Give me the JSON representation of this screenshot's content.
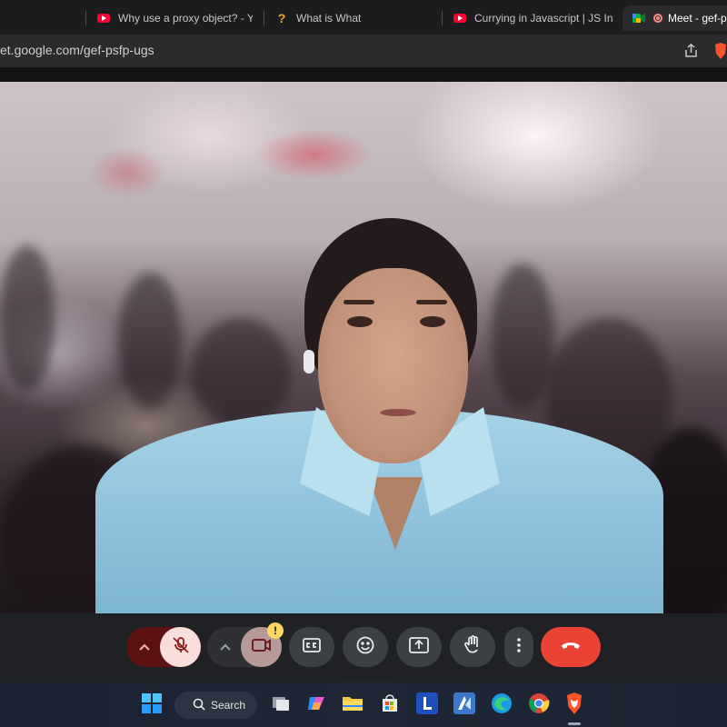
{
  "browser": {
    "tabs": [
      {
        "title": "Why use a proxy object? - You",
        "icon": "youtube-icon"
      },
      {
        "title": "What is What",
        "icon": "question-icon"
      },
      {
        "title": "Currying in Javascript | JS Inter",
        "icon": "youtube-icon"
      },
      {
        "title": "Meet - gef-ps",
        "icon": "google-meet-icon",
        "active": true
      }
    ],
    "url": "et.google.com/gef-psfp-ugs"
  },
  "meet": {
    "camera_warning_badge": "!",
    "controls": [
      {
        "name": "mic-options",
        "icon": "chevron-up-icon"
      },
      {
        "name": "mic",
        "icon": "mic-off-icon",
        "state": "muted"
      },
      {
        "name": "camera-options",
        "icon": "chevron-up-icon"
      },
      {
        "name": "camera",
        "icon": "videocam-icon"
      },
      {
        "name": "captions",
        "icon": "closed-captions-icon"
      },
      {
        "name": "reactions",
        "icon": "emoji-icon"
      },
      {
        "name": "present",
        "icon": "present-screen-icon"
      },
      {
        "name": "raise-hand",
        "icon": "hand-icon"
      },
      {
        "name": "more-options",
        "icon": "more-vert-icon"
      },
      {
        "name": "leave-call",
        "icon": "call-end-icon"
      }
    ]
  },
  "taskbar": {
    "search_label": "Search",
    "apps": [
      "windows-start-icon",
      "task-view-icon",
      "copilot-icon",
      "file-explorer-icon",
      "microsoft-store-icon",
      "l-app-icon",
      "dev-tool-icon",
      "edge-icon",
      "chrome-icon",
      "brave-icon"
    ]
  },
  "colors": {
    "end_call": "#ea4335",
    "mic_muted_bg": "#f9dedc",
    "mic_group_bg": "#5c1212",
    "warning_badge": "#fdd663",
    "youtube_red": "#ff0033"
  }
}
